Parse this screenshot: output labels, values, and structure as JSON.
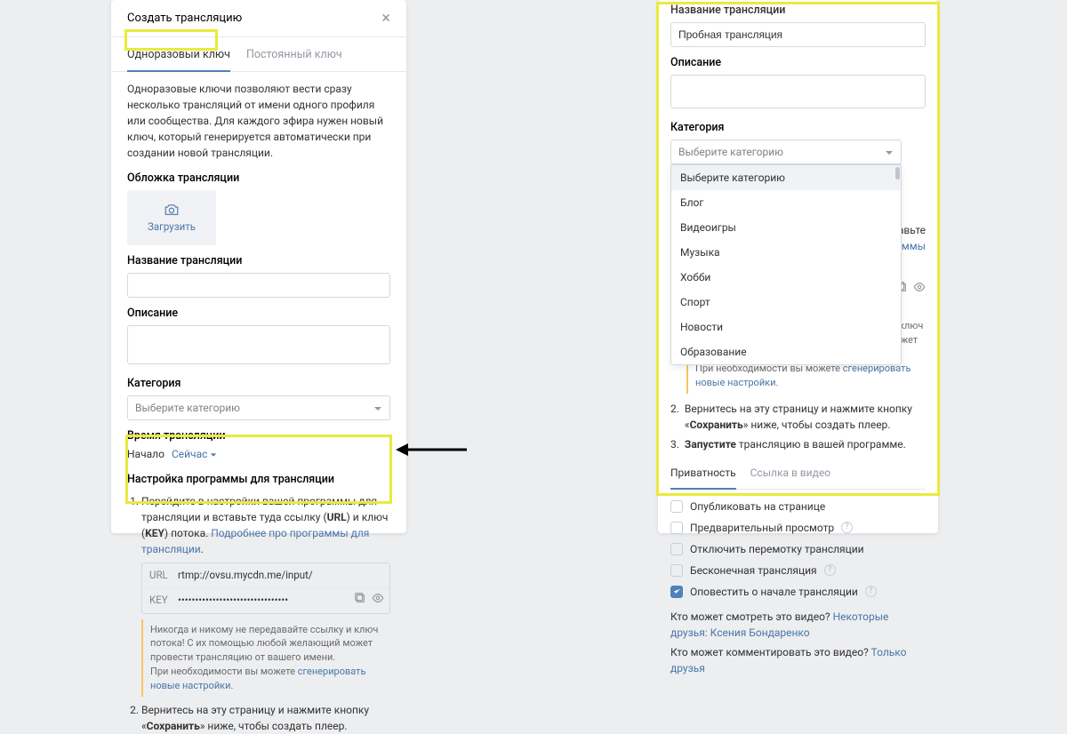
{
  "left": {
    "dialog_title": "Создать трансляцию",
    "tabs": {
      "disposable": "Одноразовый ключ",
      "permanent": "Постоянный ключ"
    },
    "desc": "Одноразовые ключи позволяют вести сразу несколько трансляций от имени одного профиля или сообщества. Для каждого эфира нужен новый ключ, который генерируется автоматически при создании новой трансляции.",
    "cover_label": "Обложка трансляции",
    "upload_label": "Загрузить",
    "title_label": "Название трансляции",
    "desc_label": "Описание",
    "category_label": "Категория",
    "category_placeholder": "Выберите категорию",
    "time_label": "Время трансляции",
    "start_label": "Начало",
    "now_label": "Сейчас",
    "setup_label": "Настройка программы для трансляции",
    "step1_pre": "Перейдите в настройки вашей программы для трансляции и вставьте туда ссылку (",
    "step1_url": "URL",
    "step1_mid": ") и ключ (",
    "step1_key": "KEY",
    "step1_post": ") потока. ",
    "step1_link": "Подробнее про программы для трансляции",
    "url_label": "URL",
    "url_value": "rtmp://ovsu.mycdn.me/input/",
    "key_label": "KEY",
    "key_value": "••••••••••••••••••••••••••••••••",
    "warn1": "Никогда и никому не передавайте ссылку и ключ потока! С их помощью любой желающий может провести трансляцию от вашего имени.",
    "warn2_pre": "При необходимости вы можете ",
    "warn2_link": "сгенерировать новые настройки",
    "step2_pre": "Вернитесь на эту страницу и нажмите кнопку «",
    "step2_bold": "Сохранить",
    "step2_post": "» ниже, чтобы создать плеер."
  },
  "right": {
    "trunc_label": "Название трансляции",
    "title_value": "Пробная трансляция",
    "desc_label": "Описание",
    "category_label": "Категория",
    "category_placeholder": "Выберите категорию",
    "dropdown_selected": "Выберите категорию",
    "dropdown_items": [
      "Блог",
      "Видеоигры",
      "Музыка",
      "Хобби",
      "Спорт",
      "Новости",
      "Образование"
    ],
    "frag_right1": "оставьте",
    "frag_right2": "аммы",
    "warn1": "Никогда и никому не передавайте ссылку и ключ потока! С их помощью любой желающий может провести трансляцию от вашего имени.",
    "warn2_pre": "При необходимости вы можете ",
    "warn2_link": "сгенерировать новые настройки",
    "step2_num": "2.",
    "step2_pre": "Вернитесь на эту страницу и нажмите кнопку «",
    "step2_bold": "Сохранить",
    "step2_post": "» ниже, чтобы создать плеер.",
    "step3_num": "3.",
    "step3_bold": "Запустите",
    "step3_post": " трансляцию в вашей программе.",
    "subtab_privacy": "Приватность",
    "subtab_link": "Ссылка в видео",
    "checks": {
      "publish": "Опубликовать на странице",
      "preview": "Предварительный просмотр",
      "no_rewind": "Отключить перемотку трансляции",
      "infinite": "Бесконечная трансляция",
      "notify": "Оповестить о начале трансляции"
    },
    "perm_watch_q": "Кто может смотреть это видео? ",
    "perm_watch_a": "Некоторые друзья: Ксения Бондаренко",
    "perm_comment_q": "Кто может комментировать это видео? ",
    "perm_comment_a": "Только друзья"
  }
}
